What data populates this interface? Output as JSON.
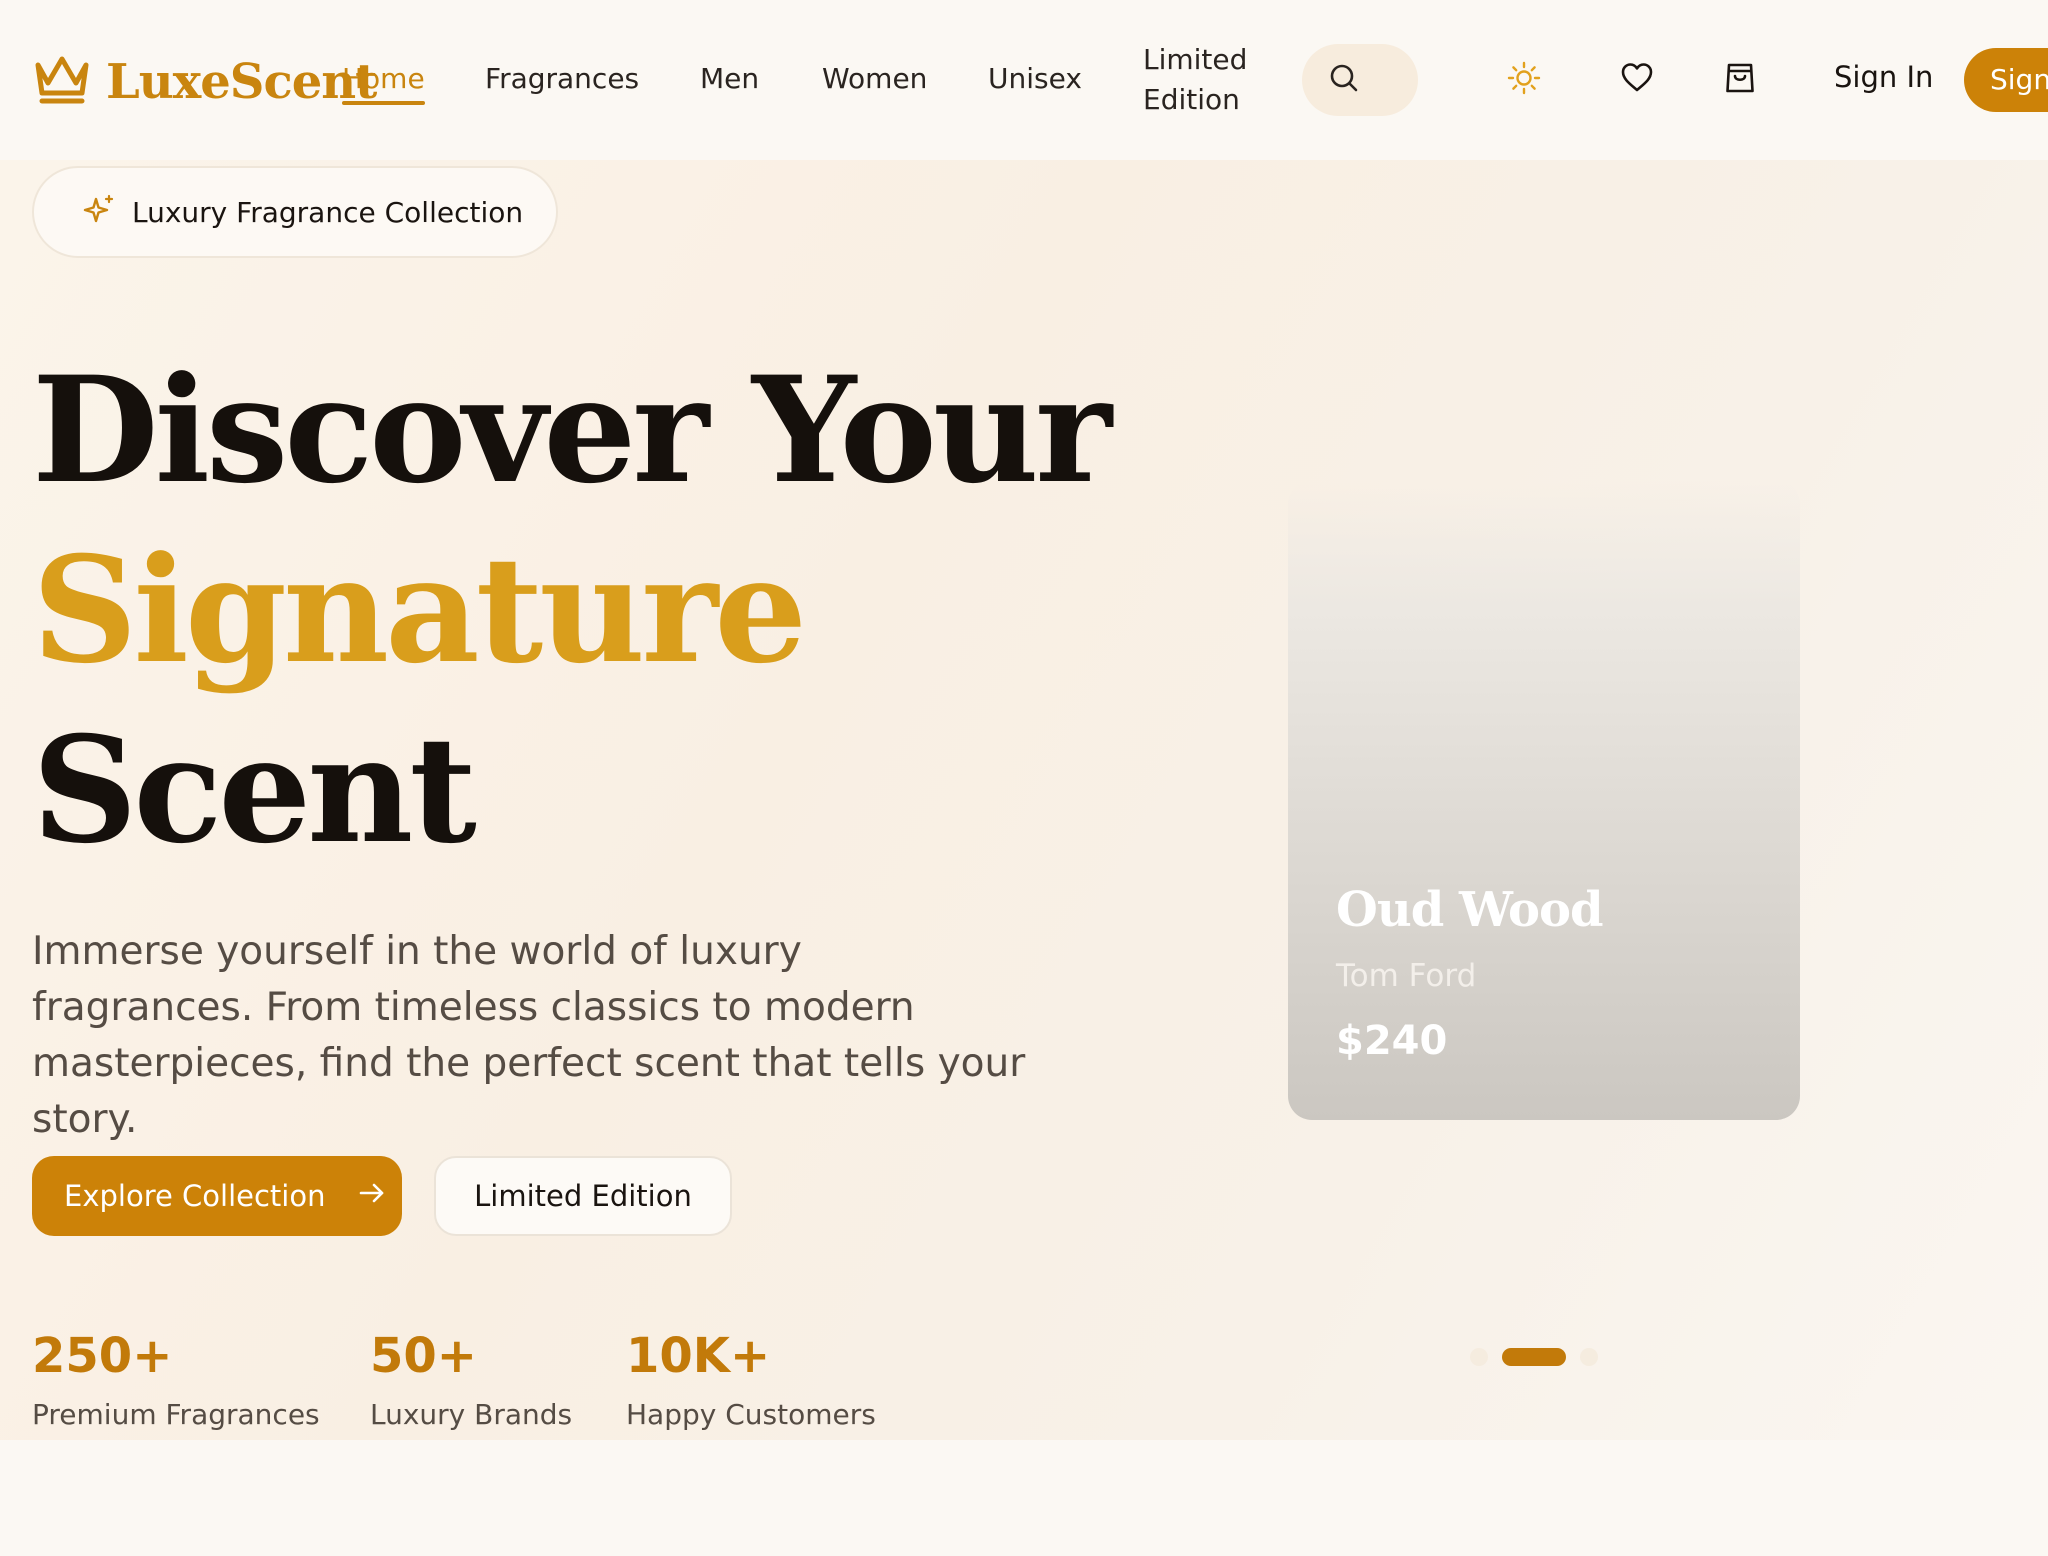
{
  "brand": {
    "name": "LuxeScent",
    "logo_icon": "crown-icon"
  },
  "nav": {
    "items": [
      {
        "label": "Home",
        "active": true
      },
      {
        "label": "Fragrances"
      },
      {
        "label": "Men"
      },
      {
        "label": "Women"
      },
      {
        "label": "Unisex"
      },
      {
        "label": "Limited Edition"
      }
    ]
  },
  "header_actions": {
    "search_icon": "search-icon",
    "theme_icon": "sun-icon",
    "wishlist_icon": "heart-icon",
    "cart_icon": "shopping-bag-icon",
    "sign_in": "Sign In",
    "sign_up": "Sign"
  },
  "hero": {
    "badge": {
      "icon": "sparkles-icon",
      "label": "Luxury Fragrance Collection"
    },
    "headline": {
      "line1": "Discover Your",
      "line2": "Signature",
      "line3": "Scent"
    },
    "description": "Immerse yourself in the world of luxury fragrances. From timeless classics to modern masterpieces, find the perfect scent that tells your story.",
    "primary_cta": "Explore Collection",
    "secondary_cta": "Limited Edition",
    "stats": [
      {
        "value": "250+",
        "label": "Premium Fragrances"
      },
      {
        "value": "50+",
        "label": "Luxury Brands"
      },
      {
        "value": "10K+",
        "label": "Happy Customers"
      }
    ]
  },
  "featured": {
    "name": "Oud Wood",
    "brand": "Tom Ford",
    "price": "$240",
    "carousel": {
      "total": 3,
      "active_index": 1
    }
  },
  "colors": {
    "accent": "#cc8208",
    "gold_text": "#d99e1c",
    "background": "#fbf8f3",
    "text_dark": "#15100c"
  }
}
